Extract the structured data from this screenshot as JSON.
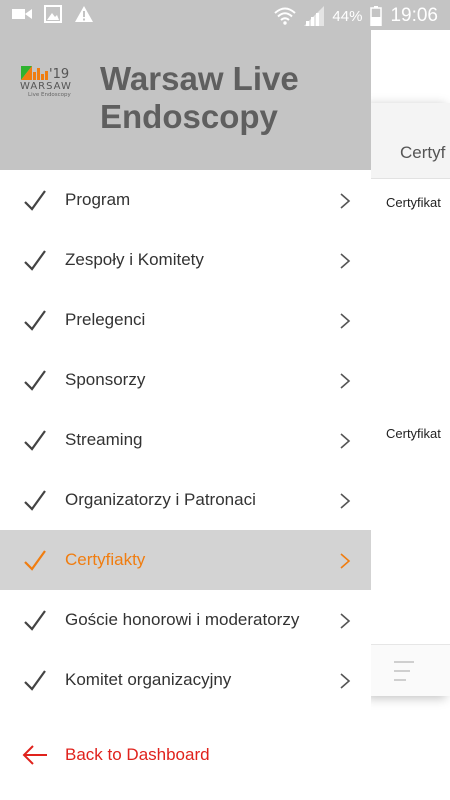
{
  "status_bar": {
    "battery_percent": "44%",
    "time": "19:06"
  },
  "app": {
    "title_line1": "Warsaw Live",
    "title_line2": "Endoscopy",
    "logo": {
      "year": "'19",
      "name": "WARSAW",
      "subtitle": "Live Endoscopy"
    }
  },
  "menu": {
    "items": [
      {
        "label": "Program",
        "active": false
      },
      {
        "label": "Zespoły i Komitety",
        "active": false
      },
      {
        "label": "Prelegenci",
        "active": false
      },
      {
        "label": "Sponsorzy",
        "active": false
      },
      {
        "label": "Streaming",
        "active": false
      },
      {
        "label": "Organizatorzy i Patronaci",
        "active": false
      },
      {
        "label": "Certyfiakty",
        "active": true
      },
      {
        "label": "Goście honorowi i moderatorzy",
        "active": false
      },
      {
        "label": "Komitet organizacyjny",
        "active": false
      }
    ],
    "back_label": "Back to Dashboard"
  },
  "background_page": {
    "header_title": "Certyf",
    "items": [
      "Certyfikat",
      "Certyfikat"
    ]
  },
  "colors": {
    "accent": "#f07d10",
    "back_link": "#e0221c",
    "header_bg": "#c4c4c4",
    "active_bg": "#d3d3d3"
  }
}
